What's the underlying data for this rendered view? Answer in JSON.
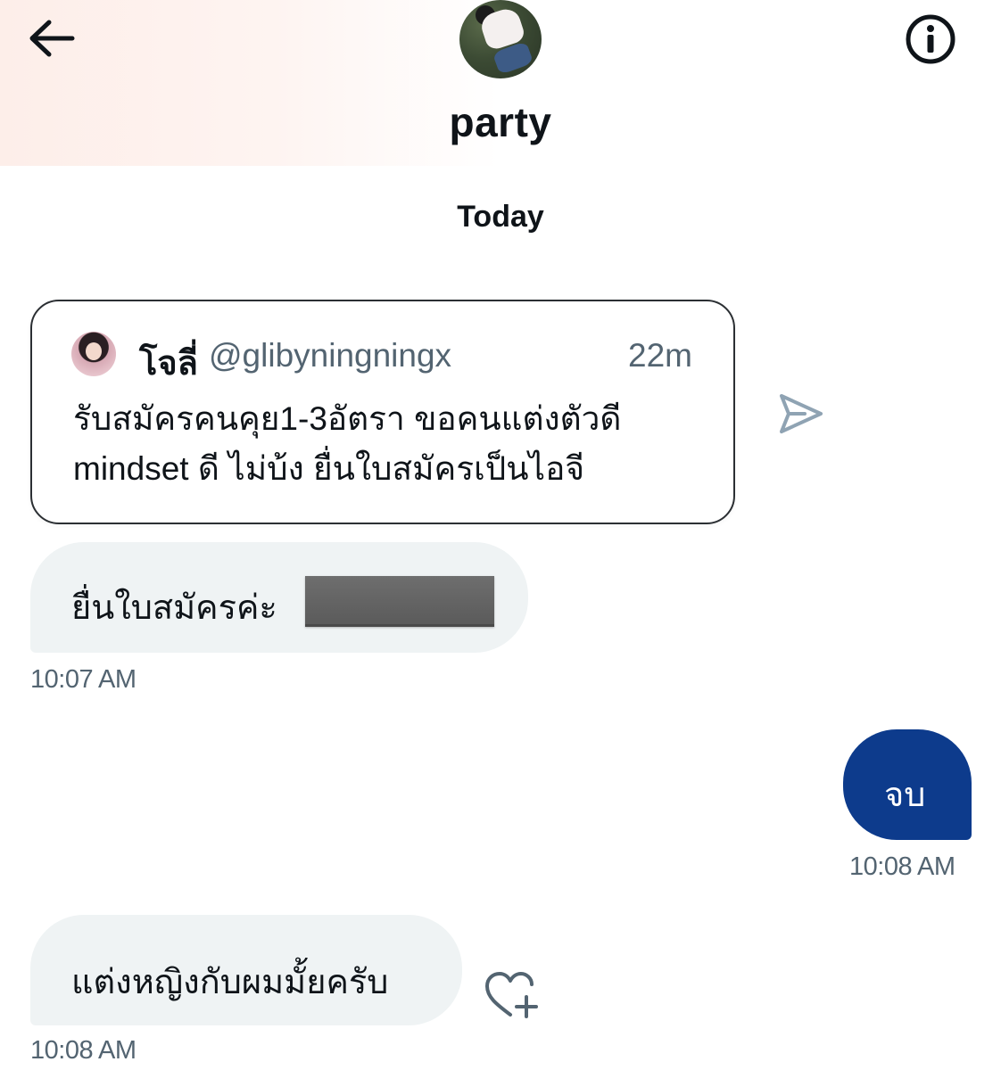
{
  "header": {
    "title": "party",
    "back_icon": "arrow-left-icon",
    "info_icon": "info-icon"
  },
  "date_separator": "Today",
  "quoted_post": {
    "author_name": "โจลี่",
    "author_handle": "@glibyningningx",
    "age": "22m",
    "text": "รับสมัครคนคุย1-3อัตรา ขอคนแต่งตัวดี mindset ดี ไม่บ้ง ยื่นใบสมัครเป็นไอจี",
    "share_icon": "send-icon"
  },
  "messages": [
    {
      "direction": "incoming",
      "text": "ยื่นใบสมัครค่ะ",
      "time": "10:07 AM"
    },
    {
      "direction": "outgoing",
      "text": "จบ",
      "time": "10:08 AM"
    },
    {
      "direction": "incoming",
      "text": "แต่งหญิงกับผมมั้ยครับ",
      "time": "10:08 AM"
    }
  ],
  "colors": {
    "outgoing_bubble": "#0d3b8c",
    "incoming_bubble": "#eff3f4",
    "secondary_text": "#536471"
  }
}
